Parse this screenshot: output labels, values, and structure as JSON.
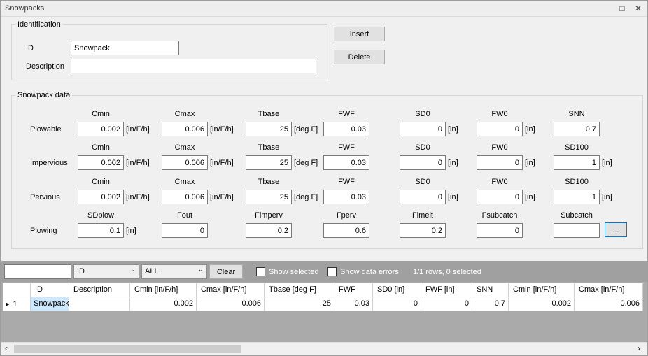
{
  "window": {
    "title": "Snowpacks"
  },
  "identification": {
    "group_title": "Identification",
    "id_label": "ID",
    "id_value": "Snowpack",
    "description_label": "Description",
    "description_value": "",
    "insert_label": "Insert",
    "delete_label": "Delete"
  },
  "snowpack_data": {
    "group_title": "Snowpack data",
    "rows": [
      {
        "label": "Plowable",
        "fields": [
          {
            "header": "Cmin",
            "value": "0.002",
            "unit": "[in/F/h]"
          },
          {
            "header": "Cmax",
            "value": "0.006",
            "unit": "[in/F/h]"
          },
          {
            "header": "Tbase",
            "value": "25",
            "unit": "[deg F]"
          },
          {
            "header": "FWF",
            "value": "0.03",
            "unit": ""
          },
          {
            "header": "SD0",
            "value": "0",
            "unit": "[in]"
          },
          {
            "header": "FW0",
            "value": "0",
            "unit": "[in]"
          },
          {
            "header": "SNN",
            "value": "0.7",
            "unit": ""
          }
        ]
      },
      {
        "label": "Impervious",
        "fields": [
          {
            "header": "Cmin",
            "value": "0.002",
            "unit": "[in/F/h]"
          },
          {
            "header": "Cmax",
            "value": "0.006",
            "unit": "[in/F/h]"
          },
          {
            "header": "Tbase",
            "value": "25",
            "unit": "[deg F]"
          },
          {
            "header": "FWF",
            "value": "0.03",
            "unit": ""
          },
          {
            "header": "SD0",
            "value": "0",
            "unit": "[in]"
          },
          {
            "header": "FW0",
            "value": "0",
            "unit": "[in]"
          },
          {
            "header": "SD100",
            "value": "1",
            "unit": "[in]"
          }
        ]
      },
      {
        "label": "Pervious",
        "fields": [
          {
            "header": "Cmin",
            "value": "0.002",
            "unit": "[in/F/h]"
          },
          {
            "header": "Cmax",
            "value": "0.006",
            "unit": "[in/F/h]"
          },
          {
            "header": "Tbase",
            "value": "25",
            "unit": "[deg F]"
          },
          {
            "header": "FWF",
            "value": "0.03",
            "unit": ""
          },
          {
            "header": "SD0",
            "value": "0",
            "unit": "[in]"
          },
          {
            "header": "FW0",
            "value": "0",
            "unit": "[in]"
          },
          {
            "header": "SD100",
            "value": "1",
            "unit": "[in]"
          }
        ]
      },
      {
        "label": "Plowing",
        "fields": [
          {
            "header": "SDplow",
            "value": "0.1",
            "unit": "[in]"
          },
          {
            "header": "Fout",
            "value": "0",
            "unit": ""
          },
          {
            "header": "Fimperv",
            "value": "0.2",
            "unit": ""
          },
          {
            "header": "Fperv",
            "value": "0.6",
            "unit": ""
          },
          {
            "header": "Fimelt",
            "value": "0.2",
            "unit": ""
          },
          {
            "header": "Fsubcatch",
            "value": "0",
            "unit": ""
          },
          {
            "header": "Subcatch",
            "value": "",
            "unit": ""
          }
        ],
        "browse_label": "..."
      }
    ]
  },
  "filter": {
    "search_value": "",
    "field_select": "ID",
    "scope_select": "ALL",
    "clear_label": "Clear",
    "show_selected_label": "Show selected",
    "show_errors_label": "Show data errors",
    "status": "1/1 rows, 0 selected"
  },
  "table": {
    "columns": [
      "ID",
      "Description",
      "Cmin [in/F/h]",
      "Cmax [in/F/h]",
      "Tbase [deg F]",
      "FWF",
      "SD0 [in]",
      "FWF [in]",
      "SNN",
      "Cmin [in/F/h]",
      "Cmax [in/F/h]"
    ],
    "rows": [
      {
        "marker": "▸",
        "index": "1",
        "cells": [
          "Snowpack",
          "",
          "0.002",
          "0.006",
          "25",
          "0.03",
          "0",
          "0",
          "0.7",
          "0.002",
          "0.006"
        ]
      }
    ]
  },
  "colors": {
    "selected_cell": "#cce8ff",
    "focus_border": "#0078d7",
    "filter_bar": "#a0a0a0"
  }
}
